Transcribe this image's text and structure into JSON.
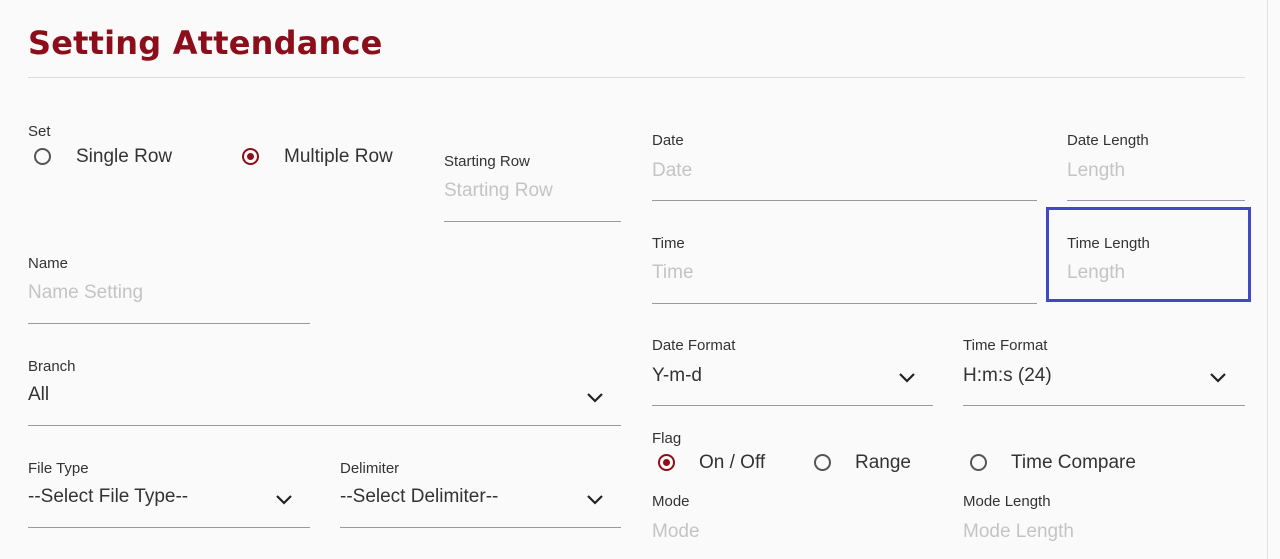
{
  "page": {
    "title": "Setting Attendance"
  },
  "set": {
    "label": "Set",
    "options": [
      "Single Row",
      "Multiple Row"
    ],
    "selected": "Multiple Row"
  },
  "starting_row": {
    "label": "Starting Row",
    "placeholder": "Starting Row"
  },
  "name": {
    "label": "Name",
    "placeholder": "Name Setting"
  },
  "branch": {
    "label": "Branch",
    "value": "All"
  },
  "file_type": {
    "label": "File Type",
    "value": "--Select File Type--"
  },
  "delimiter": {
    "label": "Delimiter",
    "value": "--Select Delimiter--"
  },
  "date": {
    "label": "Date",
    "placeholder": "Date"
  },
  "date_length": {
    "label": "Date Length",
    "placeholder": "Length"
  },
  "time": {
    "label": "Time",
    "placeholder": "Time"
  },
  "time_length": {
    "label": "Time Length",
    "placeholder": "Length"
  },
  "date_format": {
    "label": "Date Format",
    "value": "Y-m-d"
  },
  "time_format": {
    "label": "Time Format",
    "value": "H:m:s (24)"
  },
  "flag": {
    "label": "Flag",
    "options": [
      "On / Off",
      "Range",
      "Time Compare"
    ],
    "selected": "On / Off"
  },
  "mode": {
    "label": "Mode",
    "placeholder": "Mode"
  },
  "mode_length": {
    "label": "Mode Length",
    "placeholder": "Mode Length"
  },
  "colors": {
    "accent": "#8b0e1a",
    "focus": "#4047c9",
    "placeholder": "#c4c4c4"
  },
  "icons": {
    "dropdown": "chevron-down-icon"
  }
}
